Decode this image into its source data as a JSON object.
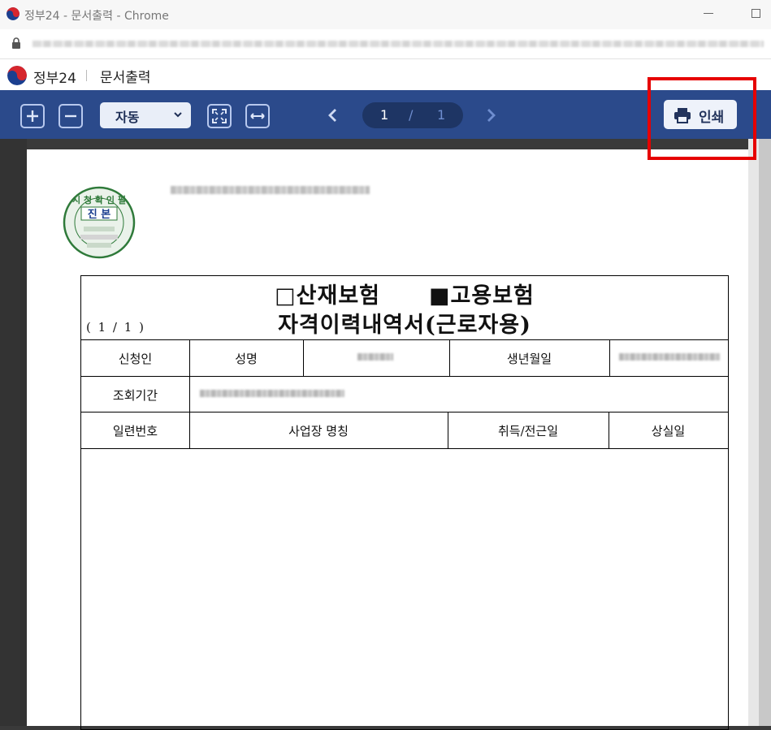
{
  "window": {
    "title": "정부24 - 문서출력 - Chrome"
  },
  "app": {
    "brand": "정부24",
    "separator": "|",
    "page_title": "문서출력"
  },
  "toolbar": {
    "zoom_value": "자동",
    "page_current": "1",
    "page_separator": "/",
    "page_total": "1",
    "print_label": "인쇄",
    "icons": [
      "zoom-in-icon",
      "zoom-out-icon",
      "fit-page-icon",
      "fit-width-icon",
      "prev-page-icon",
      "next-page-icon",
      "printer-icon"
    ]
  },
  "document": {
    "seal": {
      "top_text": "시 청 확 인 필",
      "center_text": "진 본"
    },
    "title_line1_a": "□산재보험",
    "title_line1_b": "■고용보험",
    "title_line2": "자격이력내역서(근로자용)",
    "page_indicator": "( 1 / 1 )",
    "row1": {
      "applicant_label": "신청인",
      "name_label": "성명",
      "birth_label": "생년월일"
    },
    "row2": {
      "period_label": "조회기간"
    },
    "columns": {
      "serial": "일련번호",
      "workplace": "사업장 명칭",
      "acquisition": "취득/전근일",
      "loss": "상실일"
    }
  },
  "colors": {
    "toolbar_bg": "#2b4a8b",
    "highlight": "#e60000"
  }
}
